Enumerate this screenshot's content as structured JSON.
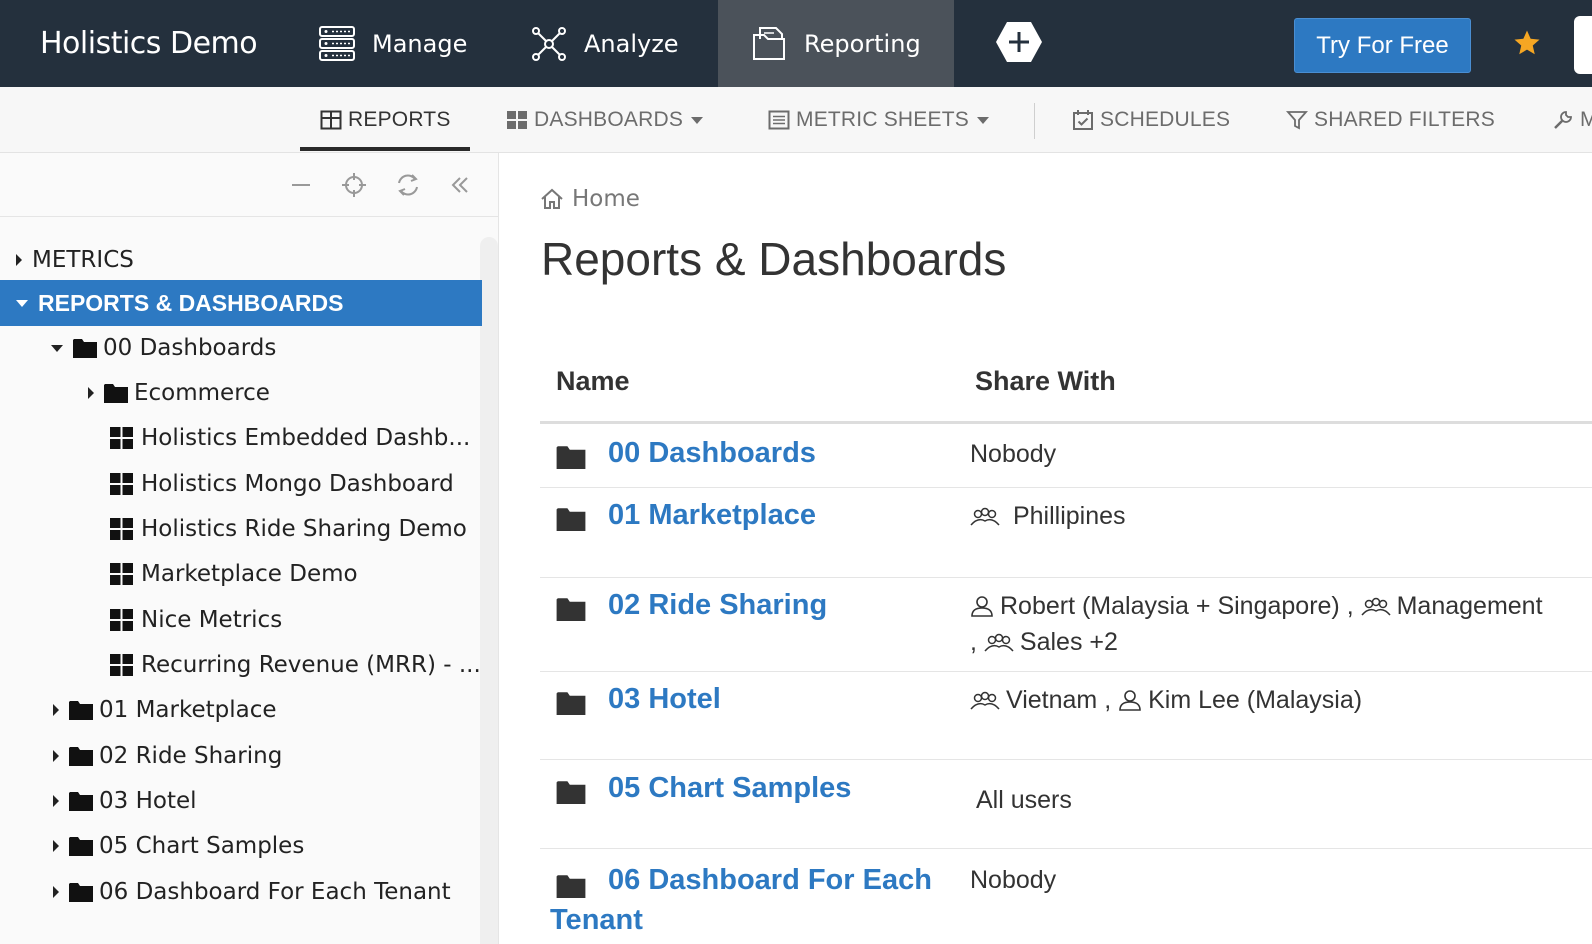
{
  "app": {
    "brand": "Holistics Demo",
    "nav": [
      {
        "label": "Manage",
        "icon": "server-icon"
      },
      {
        "label": "Analyze",
        "icon": "network-icon"
      },
      {
        "label": "Reporting",
        "icon": "report-icon",
        "active": true
      }
    ],
    "try_button": "Try For Free",
    "accent_color": "#2d79c2",
    "nav_bg_color": "#24303d"
  },
  "subnav": {
    "reports": "REPORTS",
    "dashboards": "DASHBOARDS",
    "metric_sheets": "METRIC SHEETS",
    "schedules": "SCHEDULES",
    "shared_filters": "SHARED FILTERS",
    "more": "M"
  },
  "sidebar": {
    "metrics": "METRICS",
    "reports_dashboards": "REPORTS & DASHBOARDS",
    "tree": {
      "f00": "00 Dashboards",
      "ecommerce": "Ecommerce",
      "d1": "Holistics Embedded Dashb...",
      "d2": "Holistics Mongo Dashboard",
      "d3": "Holistics Ride Sharing Demo",
      "d4": "Marketplace Demo",
      "d5": "Nice Metrics",
      "d6": "Recurring Revenue (MRR) - ...",
      "f01": "01 Marketplace",
      "f02": "02 Ride Sharing",
      "f03": "03 Hotel",
      "f05": "05 Chart Samples",
      "f06": "06 Dashboard For Each Tenant"
    }
  },
  "main": {
    "breadcrumb": "Home",
    "title": "Reports & Dashboards",
    "col_name": "Name",
    "col_share": "Share With",
    "rows": [
      {
        "name": "00 Dashboards",
        "share_text": "Nobody"
      },
      {
        "name": "01 Marketplace",
        "share_group": "Phillipines"
      },
      {
        "name": "02 Ride Sharing",
        "share_user": "Robert (Malaysia + Singapore) ,",
        "share_group1": "Management",
        "share_sep": ",",
        "share_group2": "Sales +2"
      },
      {
        "name": "03 Hotel",
        "share_group": "Vietnam ,",
        "share_user": "Kim Lee (Malaysia)"
      },
      {
        "name": "05 Chart Samples",
        "share_text": "All users"
      },
      {
        "name_line1": "06 Dashboard For Each",
        "name_line2": "Tenant",
        "share_text": "Nobody"
      }
    ]
  }
}
